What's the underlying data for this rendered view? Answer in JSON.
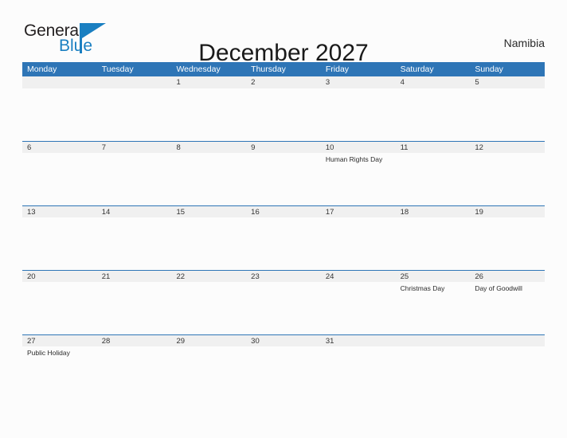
{
  "brand": {
    "name_part1": "General",
    "name_part2": "Blue",
    "flag_icon": "blue-flag-triangle-icon",
    "accent_color": "#1a7fc1"
  },
  "header": {
    "title": "December 2027",
    "country": "Namibia"
  },
  "colors": {
    "header_blue": "#2e75b6",
    "band_gray": "#f0f0f0",
    "page_background": "#fcfcfc",
    "text_dark": "#231f20"
  },
  "calendar": {
    "month": "December",
    "year": "2027",
    "weekday_headers": [
      "Monday",
      "Tuesday",
      "Wednesday",
      "Thursday",
      "Friday",
      "Saturday",
      "Sunday"
    ],
    "weeks": [
      {
        "days": [
          {
            "number": "",
            "event": ""
          },
          {
            "number": "",
            "event": ""
          },
          {
            "number": "1",
            "event": ""
          },
          {
            "number": "2",
            "event": ""
          },
          {
            "number": "3",
            "event": ""
          },
          {
            "number": "4",
            "event": ""
          },
          {
            "number": "5",
            "event": ""
          }
        ]
      },
      {
        "days": [
          {
            "number": "6",
            "event": ""
          },
          {
            "number": "7",
            "event": ""
          },
          {
            "number": "8",
            "event": ""
          },
          {
            "number": "9",
            "event": ""
          },
          {
            "number": "10",
            "event": "Human Rights Day"
          },
          {
            "number": "11",
            "event": ""
          },
          {
            "number": "12",
            "event": ""
          }
        ]
      },
      {
        "days": [
          {
            "number": "13",
            "event": ""
          },
          {
            "number": "14",
            "event": ""
          },
          {
            "number": "15",
            "event": ""
          },
          {
            "number": "16",
            "event": ""
          },
          {
            "number": "17",
            "event": ""
          },
          {
            "number": "18",
            "event": ""
          },
          {
            "number": "19",
            "event": ""
          }
        ]
      },
      {
        "days": [
          {
            "number": "20",
            "event": ""
          },
          {
            "number": "21",
            "event": ""
          },
          {
            "number": "22",
            "event": ""
          },
          {
            "number": "23",
            "event": ""
          },
          {
            "number": "24",
            "event": ""
          },
          {
            "number": "25",
            "event": "Christmas Day"
          },
          {
            "number": "26",
            "event": "Day of Goodwill"
          }
        ]
      },
      {
        "days": [
          {
            "number": "27",
            "event": "Public Holiday"
          },
          {
            "number": "28",
            "event": ""
          },
          {
            "number": "29",
            "event": ""
          },
          {
            "number": "30",
            "event": ""
          },
          {
            "number": "31",
            "event": ""
          },
          {
            "number": "",
            "event": ""
          },
          {
            "number": "",
            "event": ""
          }
        ]
      }
    ]
  }
}
